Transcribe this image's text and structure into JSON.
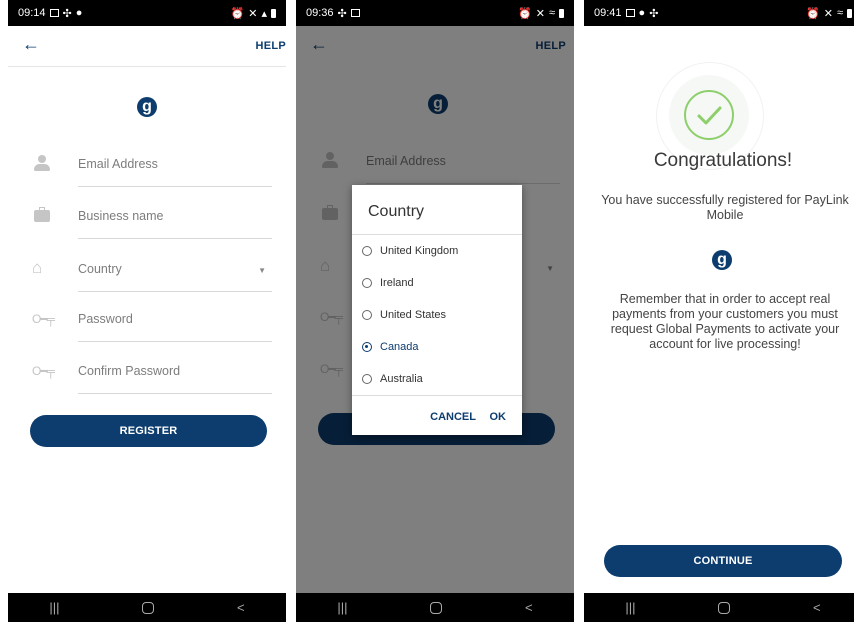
{
  "screen1": {
    "time": "09:14",
    "help": "HELP",
    "logo_letter": "g",
    "fields": {
      "email": "Email Address",
      "business": "Business name",
      "country": "Country",
      "password": "Password",
      "confirm": "Confirm Password"
    },
    "register": "REGISTER"
  },
  "screen2": {
    "time": "09:36",
    "help": "HELP",
    "logo_letter": "g",
    "email_placeholder": "Email Address",
    "dialog": {
      "title": "Country",
      "options": [
        "United Kingdom",
        "Ireland",
        "United States",
        "Canada",
        "Australia"
      ],
      "selected": "Canada",
      "cancel": "CANCEL",
      "ok": "OK"
    }
  },
  "screen3": {
    "time": "09:41",
    "title": "Congratulations!",
    "message": "You have successfully registered for PayLink Mobile",
    "logo_letter": "g",
    "notice": "Remember that in order to accept real payments from your customers you must request Global Payments to activate your account for live processing!",
    "continue": "CONTINUE"
  },
  "colors": {
    "brand": "#0d3d6e",
    "check": "#8dcf6b"
  },
  "icons": {
    "back": "arrow-left-icon",
    "person": "person-icon",
    "business": "briefcase-icon",
    "country": "home-icon",
    "password": "key-icon"
  }
}
